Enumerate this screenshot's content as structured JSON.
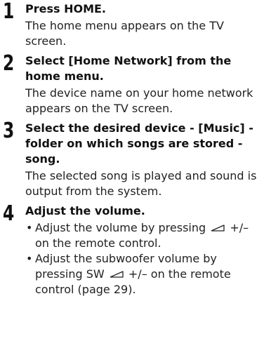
{
  "steps": [
    {
      "number": "1",
      "title": "Press HOME.",
      "body": "The home menu appears on the TV screen."
    },
    {
      "number": "2",
      "title": "Select [Home Network] from the home menu.",
      "body": "The device name on your home network appears on the TV screen."
    },
    {
      "number": "3",
      "title": "Select the desired device - [Music] - folder on which songs are stored - song.",
      "body": "The selected song is played and sound is output from the system."
    },
    {
      "number": "4",
      "title": "Adjust the volume.",
      "bullets": [
        {
          "before": "Adjust the volume by pressing",
          "icon": "volume-wedge-icon",
          "after": "+/– on the remote control."
        },
        {
          "before": "Adjust the subwoofer volume by pressing SW",
          "icon": "volume-wedge-icon",
          "after": "+/– on the remote control (page 29)."
        }
      ]
    }
  ]
}
